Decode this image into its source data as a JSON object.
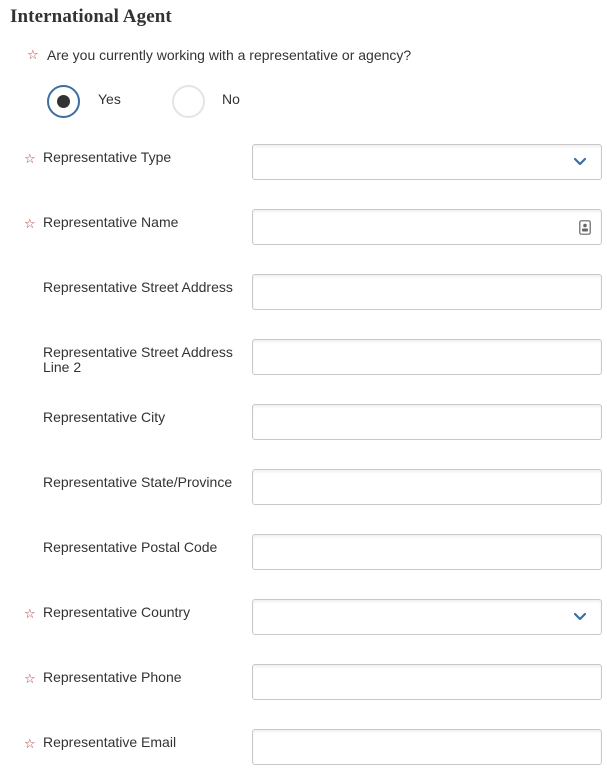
{
  "section": {
    "title": "International Agent"
  },
  "question": {
    "label": "Are you currently working with a representative or agency?",
    "options": [
      {
        "label": "Yes",
        "selected": true
      },
      {
        "label": "No",
        "selected": false
      }
    ]
  },
  "fields": [
    {
      "label": "Representative Type",
      "required": true,
      "type": "select",
      "value": ""
    },
    {
      "label": "Representative Name",
      "required": true,
      "type": "text-contact",
      "value": ""
    },
    {
      "label": "Representative Street Address",
      "required": false,
      "type": "text",
      "value": ""
    },
    {
      "label": "Representative Street Address Line 2",
      "required": false,
      "type": "text",
      "value": ""
    },
    {
      "label": "Representative City",
      "required": false,
      "type": "text",
      "value": ""
    },
    {
      "label": "Representative State/Province",
      "required": false,
      "type": "text",
      "value": ""
    },
    {
      "label": "Representative Postal Code",
      "required": false,
      "type": "text",
      "value": ""
    },
    {
      "label": "Representative Country",
      "required": true,
      "type": "select",
      "value": ""
    },
    {
      "label": "Representative Phone",
      "required": true,
      "type": "text",
      "value": ""
    },
    {
      "label": "Representative Email",
      "required": true,
      "type": "text",
      "value": ""
    }
  ],
  "required_marker": "☆",
  "colors": {
    "accent": "#3a6ea5",
    "required": "#b23b3b",
    "text": "#333333",
    "border": "#c9c9c9"
  }
}
